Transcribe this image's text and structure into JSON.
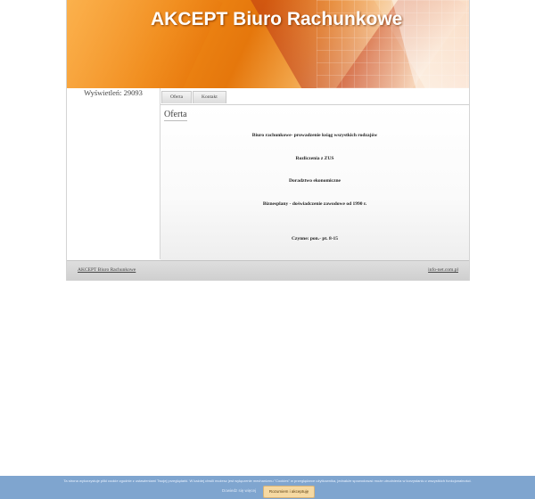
{
  "header": {
    "title": "AKCEPT Biuro Rachunkowe"
  },
  "sidebar": {
    "counter": "Wyświetleń: 29093"
  },
  "tabs": [
    {
      "label": "Oferta"
    },
    {
      "label": "Kontakt"
    }
  ],
  "content": {
    "title": "Oferta",
    "lines": [
      "Biuro rachunkowe- prowadzenie ksiąg wszystkich rodzajów",
      "Rozliczenia z ZUS",
      "Doradztwo ekonomiczne",
      "Biznesplany - doświadczenie zawodowe od 1990 r.",
      "Czynne: pon.- pt. 8-15"
    ]
  },
  "footer": {
    "left_link": "AKCEPT Biuro Rachunkowe",
    "right_link": "info-net.com.pl"
  },
  "cookie_bar": {
    "text": "Ta strona wykorzystuje pliki cookie zgodnie z ustawieniami Twojej przeglądarki. W każdej chwili możesz jest wyłączenie mechanizmu \"Cookies\" w przeglądarce użytkownika, jednakże spowodować może utrudnienia w korzystaniu z wszystkich funkcjonalności.",
    "more_label": "Dowiedz się więcej",
    "accept_label": "Rozumiem i akceptuję"
  },
  "colors": {
    "banner_orange": "#f08a17",
    "cookie_bar": "#7fa5cf",
    "accept_button": "#f6d9a2"
  }
}
